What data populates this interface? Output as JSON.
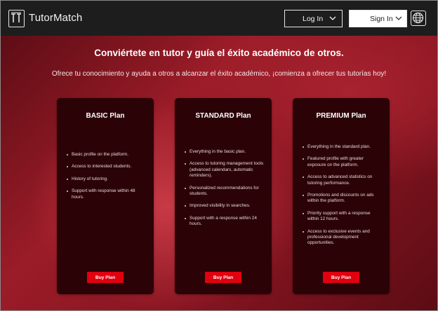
{
  "header": {
    "brand": "TutorMatch",
    "logo_icon": "tutormatch-logo-icon",
    "login_label": "Log In",
    "signin_label": "Sign In",
    "language_icon": "globe-icon"
  },
  "hero": {
    "title": "Conviértete en tutor y guía el éxito académico de otros.",
    "subtitle": "Ofrece tu conocimiento y ayuda a otros a alcanzar el éxito académico, ¡comienza a ofrecer tus tutorías hoy!"
  },
  "plans": [
    {
      "name": "BASIC Plan",
      "features": [
        "Basic profile on the platform.",
        "Access to interested students.",
        "History of tutoring.",
        "Support with response within 48 hours."
      ],
      "button": "Buy Plan"
    },
    {
      "name": "STANDARD Plan",
      "features": [
        "Everything in the basic plan.",
        "Access to tutoring management tools (advanced calendars, automatic reminders).",
        "Personalized recommendations for students.",
        "Improved visibility in searches.",
        "Support with a response within 24 hours."
      ],
      "button": "Buy Plan"
    },
    {
      "name": "PREMIUM Plan",
      "features": [
        "Everything in the standard plan.",
        "Featured profile with greater exposure on the platform.",
        "Access to advanced statistics on tutoring performance.",
        "Promotions and discounts on ads within the platform.",
        "Priority support with a response within 12 hours.",
        "Access to exclusive events and professional development opportunities."
      ],
      "button": "Buy Plan"
    }
  ],
  "colors": {
    "topbar": "#1d1d1d",
    "card": "#2b0307",
    "accent_button": "#e0000f",
    "hero_red": "#9a1c28"
  }
}
